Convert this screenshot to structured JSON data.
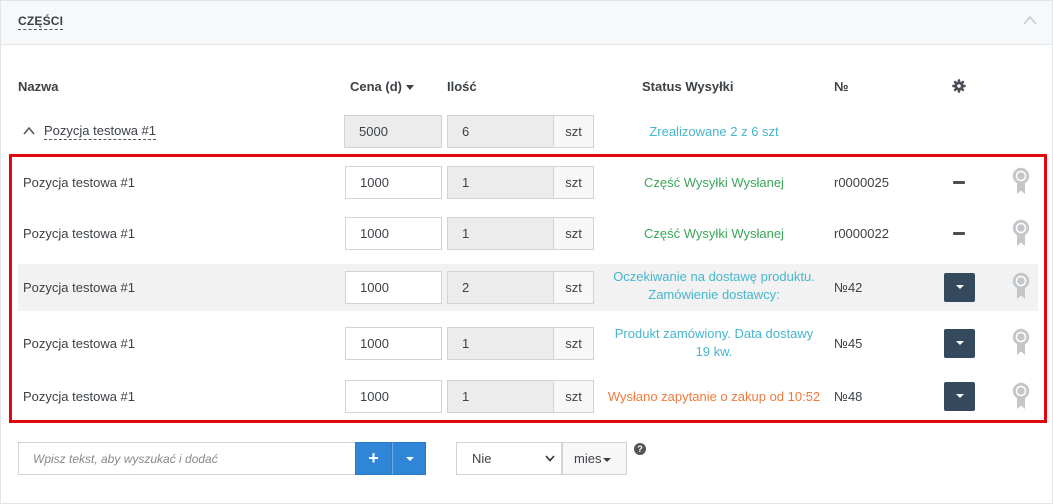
{
  "panel": {
    "title": "CZĘŚCI"
  },
  "columns": {
    "name": "Nazwa",
    "price": "Cena (d)",
    "qty": "Ilość",
    "status": "Status Wysyłki",
    "number": "№"
  },
  "group": {
    "name": "Pozycja testowa #1",
    "price": "5000",
    "qty": "6",
    "unit": "szt",
    "status": "Zrealizowane 2 z 6 szt"
  },
  "rows": [
    {
      "name": "Pozycja testowa #1",
      "price": "1000",
      "qty": "1",
      "unit": "szt",
      "status_line1": "Część Wysyłki Wysłanej",
      "status_line2": "",
      "status_color": "#3aa65a",
      "number": "r0000025",
      "action": "minus"
    },
    {
      "name": "Pozycja testowa #1",
      "price": "1000",
      "qty": "1",
      "unit": "szt",
      "status_line1": "Część Wysyłki Wysłanej",
      "status_line2": "",
      "status_color": "#3aa65a",
      "number": "r0000022",
      "action": "minus"
    },
    {
      "name": "Pozycja testowa #1",
      "price": "1000",
      "qty": "2",
      "unit": "szt",
      "status_line1": "Oczekiwanie na dostawę produktu.",
      "status_line2": "Zamówienie dostawcy:",
      "status_color": "#45b6cf",
      "number": "№42",
      "action": "dropdown"
    },
    {
      "name": "Pozycja testowa #1",
      "price": "1000",
      "qty": "1",
      "unit": "szt",
      "status_line1": "Produkt zamówiony. Data dostawy",
      "status_line2": "19 kw.",
      "status_color": "#45b6cf",
      "number": "№45",
      "action": "dropdown"
    },
    {
      "name": "Pozycja testowa #1",
      "price": "1000",
      "qty": "1",
      "unit": "szt",
      "status_line1": "Wysłano zapytanie o zakup od 10:52",
      "status_line2": "",
      "status_color": "#f0793b",
      "number": "№48",
      "action": "dropdown"
    }
  ],
  "footer": {
    "search_placeholder": "Wpisz tekst, aby wyszukać i dodać",
    "add_label": "+",
    "select_value": "Nie",
    "period_label": "mies",
    "help": "?"
  },
  "colors": {
    "accent": "#2f86d6",
    "dark_button": "#34495e",
    "highlight": "#e0070f"
  }
}
